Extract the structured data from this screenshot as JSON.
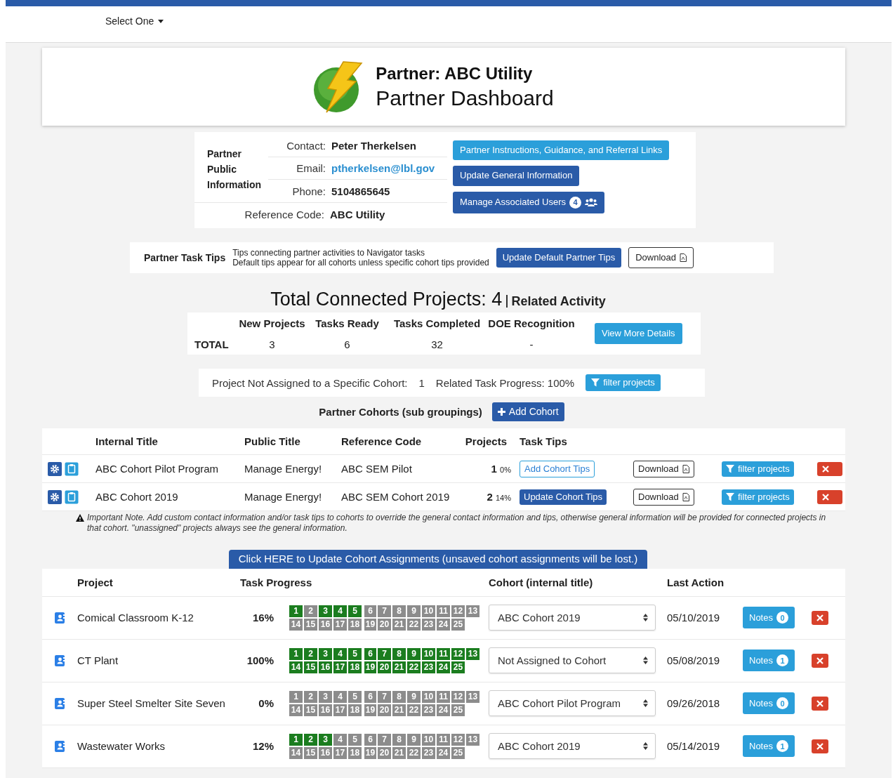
{
  "nav": {
    "dropdown": "Select One"
  },
  "header": {
    "title": "Partner: ABC Utility",
    "subtitle": "Partner Dashboard"
  },
  "partner_info": {
    "heading": "Partner Public Information",
    "fields": [
      {
        "label": "Contact:",
        "value": "Peter Therkelsen",
        "kind": "text"
      },
      {
        "label": "Email:",
        "value": "ptherkelsen@lbl.gov",
        "kind": "link"
      },
      {
        "label": "Phone:",
        "value": "5104865645",
        "kind": "text"
      }
    ],
    "reference": {
      "label": "Reference Code:",
      "value": "ABC Utility"
    },
    "buttons": [
      {
        "label": "Partner Instructions, Guidance, and Referral Links",
        "kind": "light"
      },
      {
        "label": "Update General Information",
        "kind": "dark"
      },
      {
        "label": "Manage Associated Users",
        "kind": "dark",
        "badge": "4"
      }
    ]
  },
  "task_tips": {
    "title": "Partner Task Tips",
    "lines": [
      "Tips connecting partner activities to Navigator tasks",
      "Default tips appear for all cohorts unless specific cohort tips provided"
    ],
    "buttons": [
      {
        "label": "Update Default Partner Tips",
        "kind": "dark"
      },
      {
        "label": "Download",
        "kind": "plain"
      }
    ]
  },
  "totals": {
    "title": "Total Connected Projects: 4",
    "subtitle": "Related Activity",
    "columns": [
      "New Projects",
      "Tasks Ready",
      "Tasks Completed",
      "DOE Recognition"
    ],
    "row_label": "TOTAL",
    "values": [
      "3",
      "6",
      "32",
      "-"
    ],
    "button": "View More Details"
  },
  "unassigned": {
    "label": "Project Not Assigned to a Specific Cohort:",
    "count": "1",
    "progress": "Related Task Progress: 100%",
    "button": "filter projects"
  },
  "cohorts": {
    "title": "Partner Cohorts (sub groupings)",
    "add_button": "Add Cohort",
    "columns": [
      "Internal Title",
      "Public Title",
      "Reference Code",
      "Projects",
      "Task Tips"
    ],
    "rows": [
      {
        "internal_title": "ABC Cohort Pilot Program",
        "public_title": "Manage Energy!",
        "reference_code": "ABC SEM Pilot",
        "projects": "1",
        "percent": "0%",
        "tips_button": {
          "label": "Add Cohort Tips",
          "kind": "outline"
        },
        "download": "Download",
        "filter": "filter projects"
      },
      {
        "internal_title": "ABC Cohort 2019",
        "public_title": "Manage Energy!",
        "reference_code": "ABC SEM Cohort 2019",
        "projects": "2",
        "percent": "14%",
        "tips_button": {
          "label": "Update Cohort Tips",
          "kind": "dark"
        },
        "download": "Download",
        "filter": "filter projects"
      }
    ],
    "note": "Important Note. Add custom contact information and/or task tips to cohorts to override the general contact information and tips, otherwise general information will be provided for connected projects in that cohort. \"unassigned\" projects always see the general information."
  },
  "assign_button": "Click HERE to Update Cohort Assignments (unsaved cohort assignments will be lost.)",
  "projects": {
    "columns": [
      "Project",
      "Task Progress",
      "Cohort (internal title)",
      "Last Action"
    ],
    "rows": [
      {
        "name": "Comical Classroom K-12",
        "percent": "16%",
        "cohort": "ABC Cohort 2019",
        "last_action": "05/10/2019",
        "notes": {
          "label": "Notes",
          "count": "0"
        },
        "tasks": [
          {
            "label": "1",
            "done": true
          },
          {
            "label": "2",
            "done": false
          },
          {
            "label": "3",
            "done": true
          },
          {
            "label": "4",
            "done": true
          },
          {
            "label": "5",
            "done": true
          },
          {
            "label": "6",
            "done": false
          },
          {
            "label": "7",
            "done": false
          },
          {
            "label": "8",
            "done": false
          },
          {
            "label": "9",
            "done": false
          },
          {
            "label": "10",
            "done": false
          },
          {
            "label": "11",
            "done": false
          },
          {
            "label": "12",
            "done": false
          },
          {
            "label": "13",
            "done": false
          },
          {
            "label": "14",
            "done": false
          },
          {
            "label": "15",
            "done": false
          },
          {
            "label": "16",
            "done": false
          },
          {
            "label": "17",
            "done": false
          },
          {
            "label": "18",
            "done": false
          },
          {
            "label": "19",
            "done": false
          },
          {
            "label": "20",
            "done": false
          },
          {
            "label": "21",
            "done": false
          },
          {
            "label": "22",
            "done": false
          },
          {
            "label": "23",
            "done": false
          },
          {
            "label": "24",
            "done": false
          },
          {
            "label": "25",
            "done": false
          }
        ]
      },
      {
        "name": "CT Plant",
        "percent": "100%",
        "cohort": "Not Assigned to Cohort",
        "last_action": "05/08/2019",
        "notes": {
          "label": "Notes",
          "count": "1"
        },
        "tasks": [
          {
            "label": "1",
            "done": true
          },
          {
            "label": "2",
            "done": true
          },
          {
            "label": "3",
            "done": true
          },
          {
            "label": "4",
            "done": true
          },
          {
            "label": "5",
            "done": true
          },
          {
            "label": "6",
            "done": true
          },
          {
            "label": "7",
            "done": true
          },
          {
            "label": "8",
            "done": true
          },
          {
            "label": "9",
            "done": true
          },
          {
            "label": "10",
            "done": true
          },
          {
            "label": "11",
            "done": true
          },
          {
            "label": "12",
            "done": true
          },
          {
            "label": "13",
            "done": true
          },
          {
            "label": "14",
            "done": true
          },
          {
            "label": "15",
            "done": true
          },
          {
            "label": "16",
            "done": true
          },
          {
            "label": "17",
            "done": true
          },
          {
            "label": "18",
            "done": true
          },
          {
            "label": "19",
            "done": true
          },
          {
            "label": "20",
            "done": true
          },
          {
            "label": "21",
            "done": true
          },
          {
            "label": "22",
            "done": true
          },
          {
            "label": "23",
            "done": true
          },
          {
            "label": "24",
            "done": true
          },
          {
            "label": "25",
            "done": true
          }
        ]
      },
      {
        "name": "Super Steel Smelter Site Seven",
        "percent": "0%",
        "cohort": "ABC Cohort Pilot Program",
        "last_action": "09/26/2018",
        "notes": {
          "label": "Notes",
          "count": "0"
        },
        "tasks": [
          {
            "label": "1",
            "done": false
          },
          {
            "label": "2",
            "done": false
          },
          {
            "label": "3",
            "done": false
          },
          {
            "label": "4",
            "done": false
          },
          {
            "label": "5",
            "done": false
          },
          {
            "label": "6",
            "done": false
          },
          {
            "label": "7",
            "done": false
          },
          {
            "label": "8",
            "done": false
          },
          {
            "label": "9",
            "done": false
          },
          {
            "label": "10",
            "done": false
          },
          {
            "label": "11",
            "done": false
          },
          {
            "label": "12",
            "done": false
          },
          {
            "label": "13",
            "done": false
          },
          {
            "label": "14",
            "done": false
          },
          {
            "label": "15",
            "done": false
          },
          {
            "label": "16",
            "done": false
          },
          {
            "label": "17",
            "done": false
          },
          {
            "label": "18",
            "done": false
          },
          {
            "label": "19",
            "done": false
          },
          {
            "label": "20",
            "done": false
          },
          {
            "label": "21",
            "done": false
          },
          {
            "label": "22",
            "done": false
          },
          {
            "label": "23",
            "done": false
          },
          {
            "label": "24",
            "done": false
          },
          {
            "label": "25",
            "done": false
          }
        ]
      },
      {
        "name": "Wastewater Works",
        "percent": "12%",
        "cohort": "ABC Cohort 2019",
        "last_action": "05/14/2019",
        "notes": {
          "label": "Notes",
          "count": "1"
        },
        "tasks": [
          {
            "label": "1",
            "done": true
          },
          {
            "label": "2",
            "done": true
          },
          {
            "label": "3",
            "done": true
          },
          {
            "label": "4",
            "done": false
          },
          {
            "label": "5",
            "done": false
          },
          {
            "label": "6",
            "done": false
          },
          {
            "label": "7",
            "done": false
          },
          {
            "label": "8",
            "done": false
          },
          {
            "label": "9",
            "done": false
          },
          {
            "label": "10",
            "done": false
          },
          {
            "label": "11",
            "done": false
          },
          {
            "label": "12",
            "done": false
          },
          {
            "label": "13",
            "done": false
          },
          {
            "label": "14",
            "done": false
          },
          {
            "label": "15",
            "done": false
          },
          {
            "label": "16",
            "done": false
          },
          {
            "label": "17",
            "done": false
          },
          {
            "label": "18",
            "done": false
          },
          {
            "label": "19",
            "done": false
          },
          {
            "label": "20",
            "done": false
          },
          {
            "label": "21",
            "done": false
          },
          {
            "label": "22",
            "done": false
          },
          {
            "label": "23",
            "done": false
          },
          {
            "label": "24",
            "done": false
          },
          {
            "label": "25",
            "done": false
          }
        ]
      }
    ]
  }
}
